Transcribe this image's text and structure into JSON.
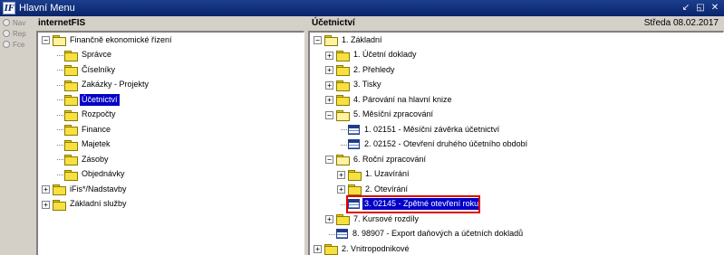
{
  "window": {
    "title": "Hlavní Menu",
    "icon_letter": "IF"
  },
  "window_controls": [
    "↙",
    "◱",
    "✕"
  ],
  "leftnav": {
    "options": [
      "Nav",
      "Rep",
      "Fce"
    ]
  },
  "left_pane": {
    "title": "internetFIS",
    "items": [
      {
        "label": "Finančně ekonomické řízení",
        "level": 0,
        "type": "folder-open",
        "expander": "−"
      },
      {
        "label": "Správce",
        "level": 1,
        "type": "folder"
      },
      {
        "label": "Číselníky",
        "level": 1,
        "type": "folder"
      },
      {
        "label": "Zakázky - Projekty",
        "level": 1,
        "type": "folder"
      },
      {
        "label": "Účetnictví",
        "level": 1,
        "type": "folder",
        "selected": true
      },
      {
        "label": "Rozpočty",
        "level": 1,
        "type": "folder"
      },
      {
        "label": "Finance",
        "level": 1,
        "type": "folder"
      },
      {
        "label": "Majetek",
        "level": 1,
        "type": "folder"
      },
      {
        "label": "Zásoby",
        "level": 1,
        "type": "folder"
      },
      {
        "label": "Objednávky",
        "level": 1,
        "type": "folder"
      },
      {
        "label": "iFis*/Nadstavby",
        "level": 0,
        "type": "folder",
        "expander": "+"
      },
      {
        "label": "Základní služby",
        "level": 0,
        "type": "folder",
        "expander": "+"
      }
    ]
  },
  "right_pane": {
    "title": "Účetnictví",
    "date": "Středa  08.02.2017",
    "items": [
      {
        "label": "1.  Základní",
        "level": 0,
        "type": "folder-open",
        "expander": "−"
      },
      {
        "label": "1.  Účetní doklady",
        "level": 1,
        "type": "folder",
        "expander": "+"
      },
      {
        "label": "2.  Přehledy",
        "level": 1,
        "type": "folder",
        "expander": "+"
      },
      {
        "label": "3.  Tisky",
        "level": 1,
        "type": "folder",
        "expander": "+"
      },
      {
        "label": "4.  Párování na hlavní knize",
        "level": 1,
        "type": "folder",
        "expander": "+"
      },
      {
        "label": "5.  Měsíční zpracování",
        "level": 1,
        "type": "folder-open",
        "expander": "−"
      },
      {
        "label": "1.  02151 - Měsíční závěrka účetnictví",
        "level": 2,
        "type": "doc"
      },
      {
        "label": "2.  02152 - Otevření druhého účetního období",
        "level": 2,
        "type": "doc"
      },
      {
        "label": "6.  Roční zpracování",
        "level": 1,
        "type": "folder-open",
        "expander": "−"
      },
      {
        "label": "1.  Uzavírání",
        "level": 2,
        "type": "folder",
        "expander": "+"
      },
      {
        "label": "2.  Otevírání",
        "level": 2,
        "type": "folder",
        "expander": "+"
      },
      {
        "label": "3.  02145 - Zpětné otevření roku",
        "level": 2,
        "type": "doc",
        "selected": true
      },
      {
        "label": "7.  Kursové rozdíly",
        "level": 1,
        "type": "folder",
        "expander": "+"
      },
      {
        "label": "8.  98907 - Export daňových a účetních dokladů",
        "level": 1,
        "type": "doc"
      },
      {
        "label": "2.  Vnitropodnikové",
        "level": 0,
        "type": "folder",
        "expander": "+"
      }
    ]
  }
}
